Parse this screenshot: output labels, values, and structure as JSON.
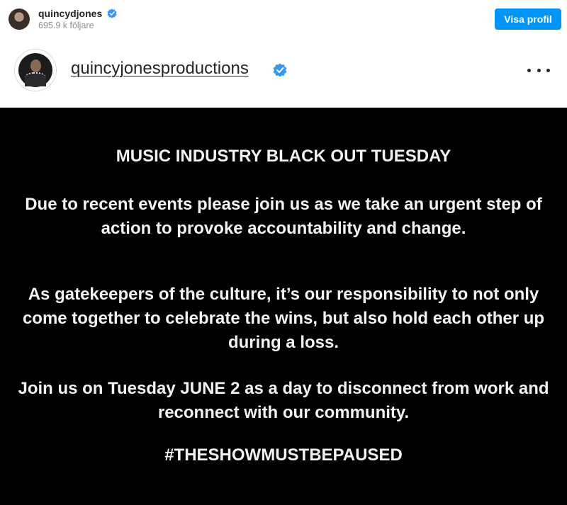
{
  "topbar": {
    "username": "quincydjones",
    "followers": "695.9 k följare",
    "visit_profile_label": "Visa profil"
  },
  "post": {
    "username": "quincyjonesproductions",
    "verified_icon": "verified-badge-icon",
    "more_icon": "more-options-icon"
  },
  "image": {
    "heading": "MUSIC INDUSTRY BLACK OUT TUESDAY",
    "paragraph1": "Due to recent events please join us as we take an urgent step of action to provoke accountability and change.",
    "paragraph2": "As gatekeepers of the culture, it’s our responsibility to not only come together to celebrate the wins, but also hold each other up during a loss.",
    "paragraph3": "Join us on Tuesday JUNE 2 as a day to disconnect from work and reconnect with our community.",
    "hashtag": "#THESHOWMUSTBEPAUSED"
  },
  "colors": {
    "accent": "#0095f6",
    "verified": "#3897f0",
    "image_bg": "#000000",
    "image_text": "#f2f2f2"
  }
}
